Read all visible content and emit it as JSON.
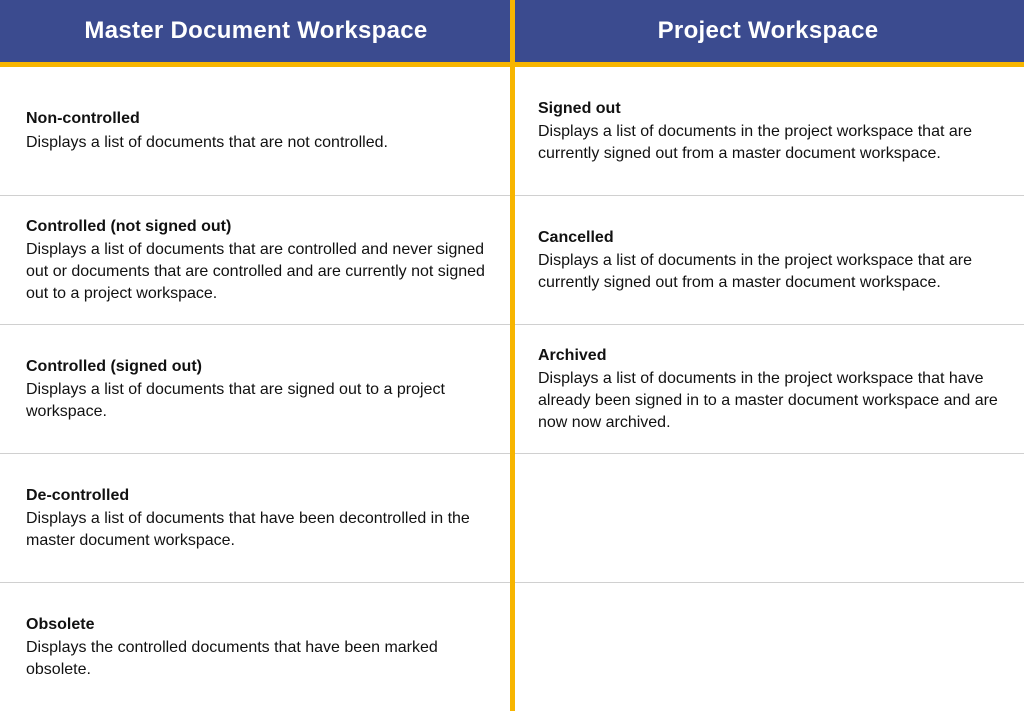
{
  "header": {
    "left": "Master Document Workspace",
    "right": "Project Workspace"
  },
  "rows": [
    {
      "left": {
        "title": "Non-controlled",
        "desc": "Displays a list of documents that are not controlled."
      },
      "right": {
        "title": "Signed out",
        "desc": "Displays a list of documents in the project workspace that are currently signed out from a master document workspace."
      }
    },
    {
      "left": {
        "title": "Controlled (not signed out)",
        "desc": "Displays a list of documents that are controlled and never signed out or documents that are controlled and are currently not signed out to a project workspace."
      },
      "right": {
        "title": "Cancelled",
        "desc": "Displays a list of documents in the project workspace that are currently signed out from a master document workspace."
      }
    },
    {
      "left": {
        "title": "Controlled (signed out)",
        "desc": "Displays a list of documents that are signed out to a project workspace."
      },
      "right": {
        "title": "Archived",
        "desc": "Displays a list of documents in the project workspace that have already been signed in to a master document workspace and are now now archived."
      }
    },
    {
      "left": {
        "title": "De-controlled",
        "desc": "Displays a list of documents that have been decontrolled in the master document workspace."
      },
      "right": null
    },
    {
      "left": {
        "title": "Obsolete",
        "desc": "Displays the controlled documents that have been marked obsolete."
      },
      "right": null
    }
  ]
}
